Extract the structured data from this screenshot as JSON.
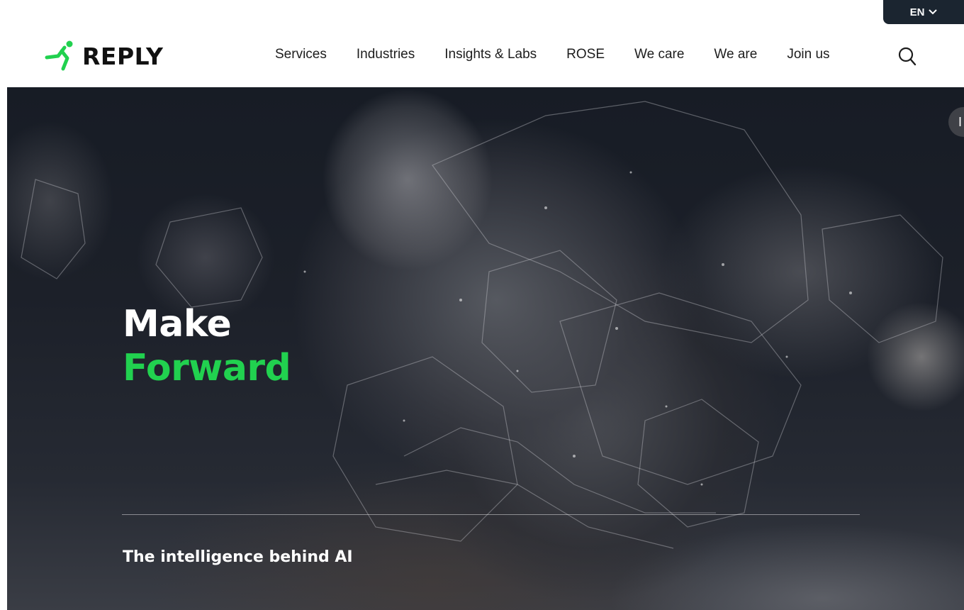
{
  "language": {
    "label": "EN"
  },
  "brand": {
    "name": "REPLY",
    "accent": "#21d14f"
  },
  "nav": {
    "items": [
      {
        "label": "Services"
      },
      {
        "label": "Industries"
      },
      {
        "label": "Insights & Labs"
      },
      {
        "label": "ROSE"
      },
      {
        "label": "We care"
      },
      {
        "label": "We are"
      },
      {
        "label": "Join us"
      }
    ],
    "search_icon": "search-icon"
  },
  "hero": {
    "title_line1": "Make",
    "title_line2": "Forward",
    "subtitle": "The intelligence behind AI",
    "side_button": "I"
  }
}
